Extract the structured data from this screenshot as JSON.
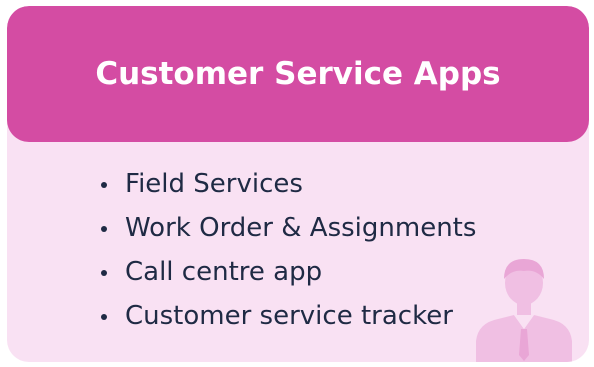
{
  "card": {
    "title": "Customer Service Apps",
    "items": [
      {
        "label": "Field Services"
      },
      {
        "label": "Work Order & Assignments"
      },
      {
        "label": "Call centre app"
      },
      {
        "label": "Customer service tracker"
      }
    ],
    "icon": "businessman-icon"
  },
  "colors": {
    "header": "#d44ca3",
    "body": "#f9e1f3",
    "text": "#1f2a44",
    "icon": "#f0bfe3"
  }
}
